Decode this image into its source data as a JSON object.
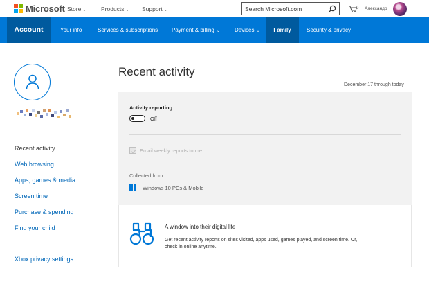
{
  "header": {
    "brand": "Microsoft",
    "nav": [
      {
        "label": "Store"
      },
      {
        "label": "Products"
      },
      {
        "label": "Support"
      }
    ],
    "search": {
      "placeholder": "Search Microsoft.com",
      "value": ""
    },
    "cart_count": "0",
    "user_name": "Александр"
  },
  "account_nav": {
    "account_label": "Account",
    "items": [
      {
        "label": "Your info"
      },
      {
        "label": "Services & subscriptions"
      },
      {
        "label": "Payment & billing"
      },
      {
        "label": "Devices"
      },
      {
        "label": "Family"
      },
      {
        "label": "Security & privacy"
      }
    ]
  },
  "sidebar": {
    "items": [
      {
        "label": "Recent activity"
      },
      {
        "label": "Web browsing"
      },
      {
        "label": "Apps, games & media"
      },
      {
        "label": "Screen time"
      },
      {
        "label": "Purchase & spending"
      },
      {
        "label": "Find your child"
      },
      {
        "label": "Xbox privacy settings"
      }
    ]
  },
  "main": {
    "title": "Recent activity",
    "date_range": "December 17 through today",
    "activity_reporting": {
      "label": "Activity reporting",
      "state": "Off"
    },
    "email_reports_label": "Email weekly reports to me",
    "collected_from": {
      "label": "Collected from",
      "device": "Windows 10 PCs & Mobile"
    },
    "promo": {
      "title": "A window into their digital life",
      "description": "Get recent activity reports on sites visited, apps used, games played, and screen time. Or, check in online anytime."
    }
  },
  "colors": {
    "accent": "#0078d7",
    "accent_dark": "#005a9e",
    "link": "#0067b8",
    "panel_bg": "#f2f2f2"
  },
  "icons": [
    "microsoft-logo",
    "search-icon",
    "cart-icon",
    "user-icon",
    "windows-logo-icon",
    "binoculars-icon"
  ]
}
